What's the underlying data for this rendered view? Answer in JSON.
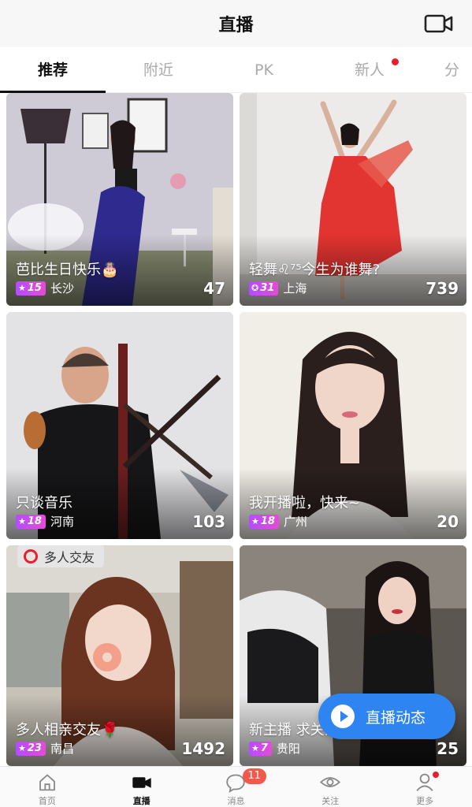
{
  "header": {
    "title": "直播",
    "camera_icon": "video-camera-icon"
  },
  "tabs": [
    {
      "label": "推荐",
      "active": true
    },
    {
      "label": "附近",
      "active": false
    },
    {
      "label": "PK",
      "active": false
    },
    {
      "label": "新人",
      "active": false,
      "has_dot": true
    },
    {
      "label": "分",
      "active": false
    }
  ],
  "cards": [
    {
      "title": "芭比生日快乐🎂",
      "level": "15",
      "city": "长沙",
      "viewers": "47"
    },
    {
      "title": "轻舞♌⁷⁵今生为谁舞?",
      "level": "31",
      "city": "上海",
      "viewers": "739"
    },
    {
      "title": "只谈音乐",
      "level": "18",
      "city": "河南",
      "viewers": "103"
    },
    {
      "title": "我开播啦，快来~",
      "level": "18",
      "city": "广州",
      "viewers": "20"
    },
    {
      "title": "多人相亲交友🌹",
      "level": "23",
      "city": "南昌",
      "viewers": "1492"
    },
    {
      "title": "新主播 求关注",
      "level": "7",
      "city": "贵阳",
      "viewers": "25"
    }
  ],
  "tag_badge": {
    "label": "多人交友"
  },
  "fab": {
    "label": "直播动态",
    "icon": "play-icon"
  },
  "nav": [
    {
      "label": "首页",
      "icon": "home-icon"
    },
    {
      "label": "直播",
      "icon": "video-icon",
      "active": true
    },
    {
      "label": "消息",
      "icon": "chat-icon",
      "badge": "11"
    },
    {
      "label": "关注",
      "icon": "eye-icon"
    },
    {
      "label": "更多",
      "icon": "person-icon",
      "has_dot": true
    }
  ],
  "colors": {
    "accent": "#2e84f0",
    "badge_red": "#e8202a",
    "level_purple": "#b44cff"
  }
}
